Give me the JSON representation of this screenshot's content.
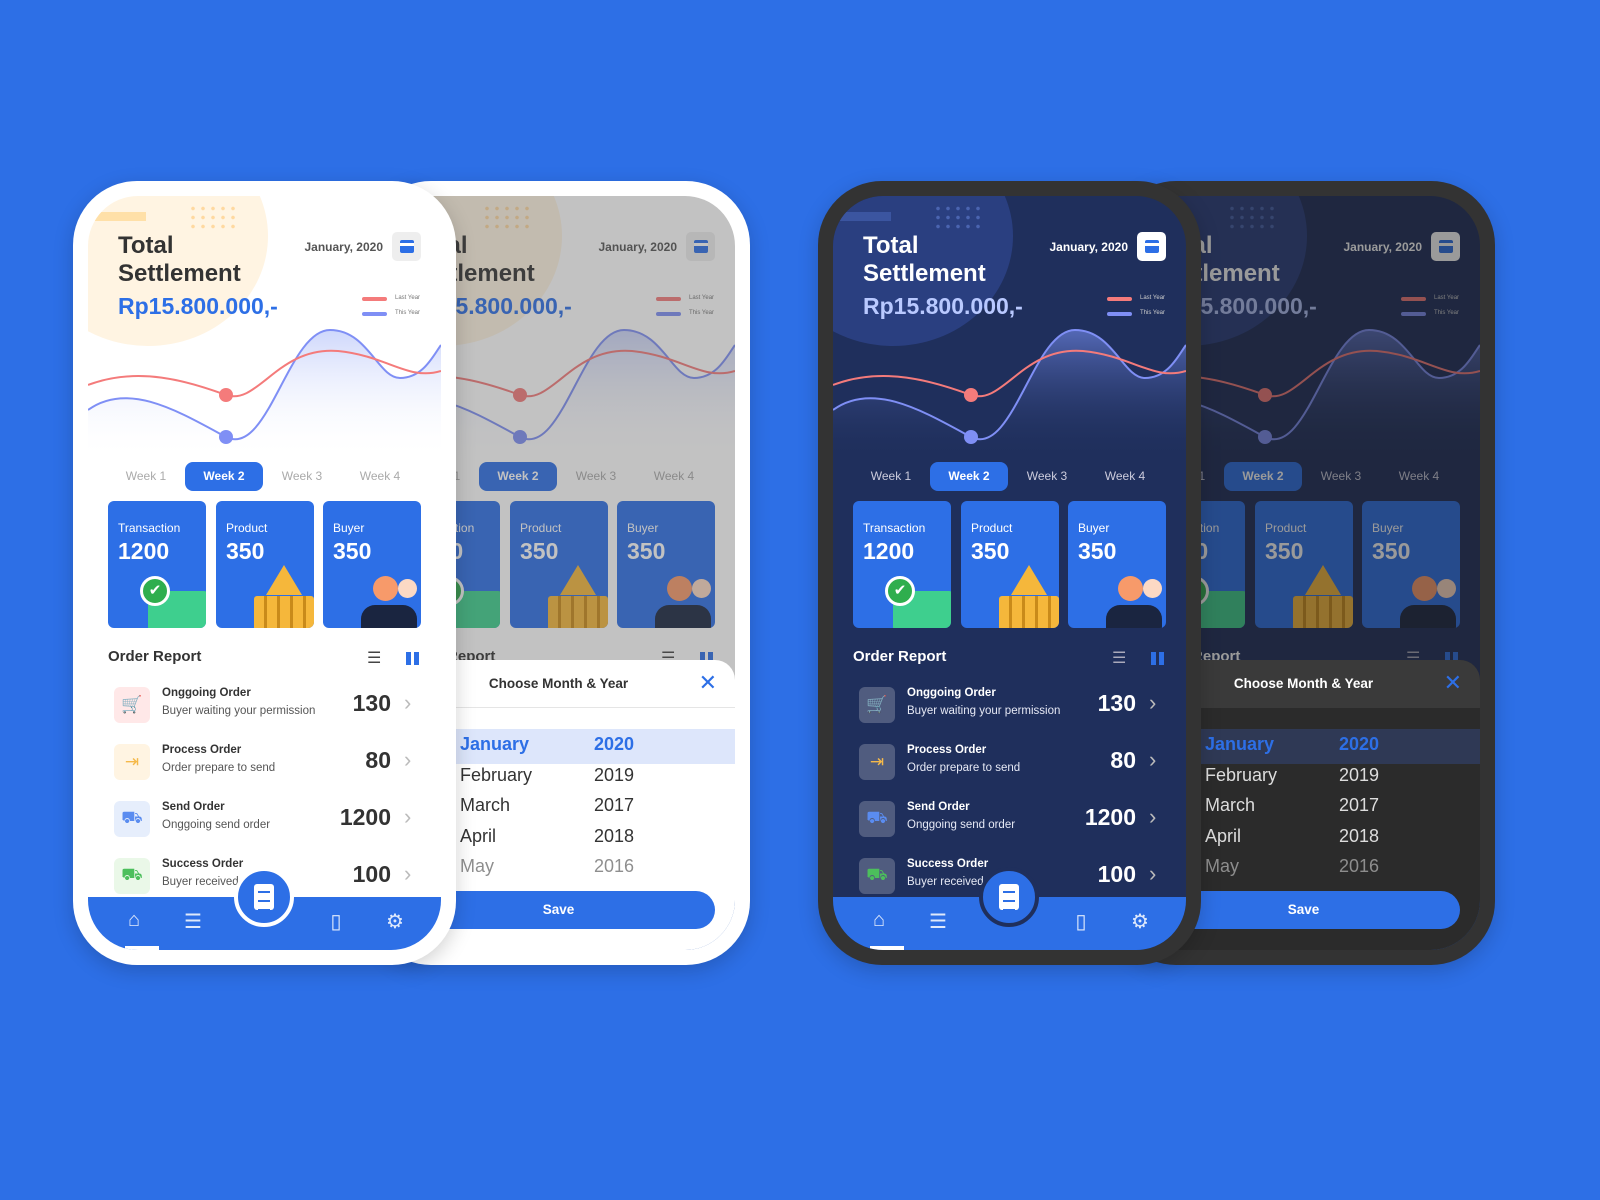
{
  "header": {
    "title_line1": "Total",
    "title_line2": "Settlement",
    "amount": "Rp15.800.000,-",
    "date": "January, 2020"
  },
  "legend": [
    {
      "label": "Last Year",
      "color": "#f47b7b"
    },
    {
      "label": "This Year",
      "color": "#7f8ff5"
    }
  ],
  "weeks": [
    "Week 1",
    "Week 2",
    "Week 3",
    "Week 4"
  ],
  "active_week": 1,
  "cards": [
    {
      "label": "Transaction",
      "value": "1200"
    },
    {
      "label": "Product",
      "value": "350"
    },
    {
      "label": "Buyer",
      "value": "350"
    }
  ],
  "order_report": {
    "title": "Order Report",
    "rows": [
      {
        "title": "Onggoing Order",
        "subtitle": "Buyer waiting your permission",
        "value": "130",
        "icon": "cart-icon",
        "color": "#f47b7b",
        "bg": "#ffe8e8"
      },
      {
        "title": "Process Order",
        "subtitle": "Order prepare to send",
        "value": "80",
        "icon": "box-icon",
        "color": "#f5b94a",
        "bg": "#fff4e2"
      },
      {
        "title": "Send Order",
        "subtitle": "Onggoing send order",
        "value": "1200",
        "icon": "truck-icon",
        "color": "#5a8cf0",
        "bg": "#e6eefc"
      },
      {
        "title": "Success Order",
        "subtitle": "Buyer received",
        "value": "100",
        "icon": "delivered-truck-icon",
        "color": "#4cbf5c",
        "bg": "#eaf8e8"
      }
    ]
  },
  "nav": [
    "store-icon",
    "chat-icon",
    "clipboard-icon",
    "bag-icon",
    "settings-icon"
  ],
  "modal": {
    "title": "Choose Month & Year",
    "months": [
      "January",
      "February",
      "March",
      "April",
      "May"
    ],
    "years": [
      "2020",
      "2019",
      "2017",
      "2018",
      "2016"
    ],
    "save_label": "Save"
  },
  "themes": [
    "light",
    "dark"
  ],
  "accent": "#2d6fe6"
}
